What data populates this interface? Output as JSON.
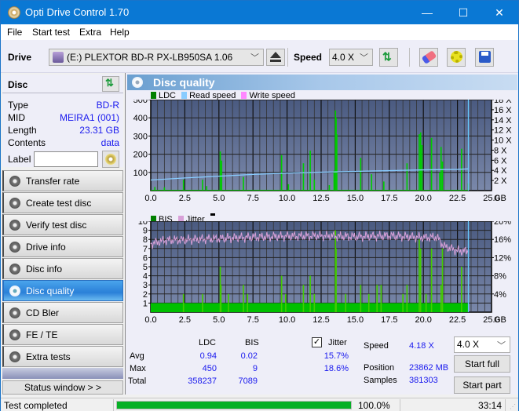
{
  "window": {
    "title": "Opti Drive Control 1.70",
    "controls": {
      "minimize": "—",
      "maximize": "☐",
      "close": "✕"
    }
  },
  "menu": [
    "File",
    "Start test",
    "Extra",
    "Help"
  ],
  "toolbar": {
    "drive_label": "Drive",
    "drive_value": "(E:)  PLEXTOR BD-R  PX-LB950SA 1.06",
    "speed_label": "Speed",
    "speed_value": "4.0 X",
    "icons": [
      "eject-icon",
      "swap-icon",
      "eraser-icon",
      "config-icon",
      "save-icon"
    ]
  },
  "disc": {
    "header": "Disc",
    "fields": [
      {
        "key": "Type",
        "value": "BD-R"
      },
      {
        "key": "MID",
        "value": "MEIRA1 (001)"
      },
      {
        "key": "Length",
        "value": "23.31 GB"
      },
      {
        "key": "Contents",
        "value": "data"
      }
    ],
    "label_key": "Label",
    "label_value": ""
  },
  "nav": [
    {
      "label": "Transfer rate",
      "active": false
    },
    {
      "label": "Create test disc",
      "active": false
    },
    {
      "label": "Verify test disc",
      "active": false
    },
    {
      "label": "Drive info",
      "active": false
    },
    {
      "label": "Disc info",
      "active": false
    },
    {
      "label": "Disc quality",
      "active": true
    },
    {
      "label": "CD Bler",
      "active": false
    },
    {
      "label": "FE / TE",
      "active": false
    },
    {
      "label": "Extra tests",
      "active": false
    }
  ],
  "status_window_button": "Status window > >",
  "panel_title": "Disc quality",
  "colors": {
    "ldc": "#00a000",
    "bis": "#00a000",
    "read_speed": "#88ccff",
    "write_speed": "#ff88ff",
    "jitter": "#d8a0d8",
    "plot_bg_top": "#4a5a80",
    "plot_bg_bottom": "#7a88aa",
    "progress": "#06b025"
  },
  "chart_data": [
    {
      "type": "bar",
      "title": "LDC / Read speed",
      "legend": [
        "LDC",
        "Read speed",
        "Write speed"
      ],
      "legend_position": "top-left",
      "xlabel": "GB",
      "x_ticks": [
        "0.0",
        "2.5",
        "5.0",
        "7.5",
        "10.0",
        "12.5",
        "15.0",
        "17.5",
        "20.0",
        "22.5",
        "25.0"
      ],
      "xlim": [
        0,
        25
      ],
      "y_ticks_left": [
        "100",
        "200",
        "300",
        "400",
        "500"
      ],
      "ylim_left": [
        0,
        500
      ],
      "y_ticks_right": [
        "2 X",
        "4 X",
        "6 X",
        "8 X",
        "10 X",
        "12 X",
        "14 X",
        "16 X",
        "18 X"
      ],
      "ylim_right": [
        0,
        18
      ],
      "grid": true,
      "ldc_spikes": [
        [
          0.3,
          20
        ],
        [
          1.0,
          18
        ],
        [
          2.4,
          60
        ],
        [
          3.8,
          60
        ],
        [
          4.1,
          25
        ],
        [
          5.1,
          215
        ],
        [
          5.2,
          165
        ],
        [
          6.8,
          75
        ],
        [
          9.6,
          195
        ],
        [
          10.1,
          35
        ],
        [
          11.2,
          150
        ],
        [
          11.7,
          220
        ],
        [
          12.0,
          60
        ],
        [
          13.1,
          30
        ],
        [
          13.45,
          110
        ],
        [
          13.55,
          440
        ],
        [
          13.6,
          400
        ],
        [
          13.65,
          310
        ],
        [
          15.4,
          180
        ],
        [
          16.2,
          90
        ],
        [
          17.1,
          50
        ],
        [
          18.8,
          150
        ],
        [
          19.7,
          310
        ],
        [
          19.8,
          320
        ],
        [
          19.9,
          250
        ],
        [
          20.6,
          290
        ],
        [
          21.2,
          100
        ],
        [
          21.3,
          240
        ],
        [
          21.4,
          160
        ],
        [
          22.8,
          230
        ],
        [
          23.3,
          40
        ]
      ],
      "read_speed": [
        [
          0.0,
          2.1
        ],
        [
          2.5,
          2.5
        ],
        [
          5.0,
          2.85
        ],
        [
          7.5,
          3.2
        ],
        [
          10.0,
          3.45
        ],
        [
          12.5,
          3.65
        ],
        [
          15.0,
          3.8
        ],
        [
          17.5,
          3.95
        ],
        [
          20.0,
          4.1
        ],
        [
          22.5,
          4.2
        ],
        [
          23.3,
          4.3
        ]
      ],
      "end_marker_gb": 23.3
    },
    {
      "type": "bar",
      "title": "BIS / Jitter",
      "legend": [
        "BIS",
        "Jitter"
      ],
      "legend_position": "top-left",
      "xlabel": "GB",
      "x_ticks": [
        "0.0",
        "2.5",
        "5.0",
        "7.5",
        "10.0",
        "12.5",
        "15.0",
        "17.5",
        "20.0",
        "22.5",
        "25.0"
      ],
      "xlim": [
        0,
        25
      ],
      "y_ticks_left": [
        "1",
        "2",
        "3",
        "4",
        "5",
        "6",
        "7",
        "8",
        "9",
        "10"
      ],
      "ylim_left": [
        0,
        10
      ],
      "y_ticks_right": [
        "4%",
        "8%",
        "12%",
        "16%",
        "20%"
      ],
      "ylim_right": [
        0,
        20
      ],
      "grid": true,
      "bis_baseline": 1,
      "bis_spikes": [
        [
          2.4,
          2
        ],
        [
          3.8,
          2
        ],
        [
          5.1,
          5
        ],
        [
          5.15,
          3
        ],
        [
          5.7,
          2
        ],
        [
          6.8,
          3
        ],
        [
          7.1,
          2
        ],
        [
          9.6,
          4
        ],
        [
          9.9,
          2
        ],
        [
          11.2,
          3
        ],
        [
          11.7,
          4
        ],
        [
          12.0,
          2
        ],
        [
          13.55,
          9
        ],
        [
          13.6,
          7
        ],
        [
          14.3,
          2
        ],
        [
          15.4,
          3
        ],
        [
          16.0,
          2
        ],
        [
          16.6,
          3
        ],
        [
          16.9,
          3
        ],
        [
          18.5,
          2
        ],
        [
          18.8,
          3
        ],
        [
          19.7,
          8
        ],
        [
          19.8,
          7
        ],
        [
          20.2,
          2
        ],
        [
          20.6,
          7
        ],
        [
          21.3,
          3
        ],
        [
          21.4,
          7
        ],
        [
          22.8,
          5
        ]
      ],
      "jitter": [
        [
          0.0,
          15.0
        ],
        [
          1.0,
          15.8
        ],
        [
          2.5,
          15.9
        ],
        [
          5.0,
          16.2
        ],
        [
          7.5,
          16.5
        ],
        [
          10.0,
          16.7
        ],
        [
          12.5,
          16.8
        ],
        [
          15.0,
          16.6
        ],
        [
          17.5,
          16.8
        ],
        [
          20.0,
          16.4
        ],
        [
          21.0,
          16.5
        ],
        [
          21.5,
          14.5
        ],
        [
          22.5,
          13.5
        ],
        [
          23.3,
          13.4
        ]
      ],
      "end_marker_gb": 23.3
    }
  ],
  "stats": {
    "col_ldc": "LDC",
    "col_bis": "BIS",
    "jitter_checked": true,
    "jitter_label": "Jitter",
    "rows": [
      {
        "label": "Avg",
        "ldc": "0.94",
        "bis": "0.02",
        "jitter": "15.7%"
      },
      {
        "label": "Max",
        "ldc": "450",
        "bis": "9",
        "jitter": "18.6%"
      },
      {
        "label": "Total",
        "ldc": "358237",
        "bis": "7089",
        "jitter": ""
      }
    ],
    "speed_label": "Speed",
    "speed_value": "4.18 X",
    "position_label": "Position",
    "position_value": "23862 MB",
    "samples_label": "Samples",
    "samples_value": "381303",
    "speed_select": "4.0 X",
    "start_full": "Start full",
    "start_part": "Start part"
  },
  "statusbar": {
    "text": "Test completed",
    "progress_percent": 100,
    "progress_text": "100.0%",
    "time": "33:14"
  }
}
